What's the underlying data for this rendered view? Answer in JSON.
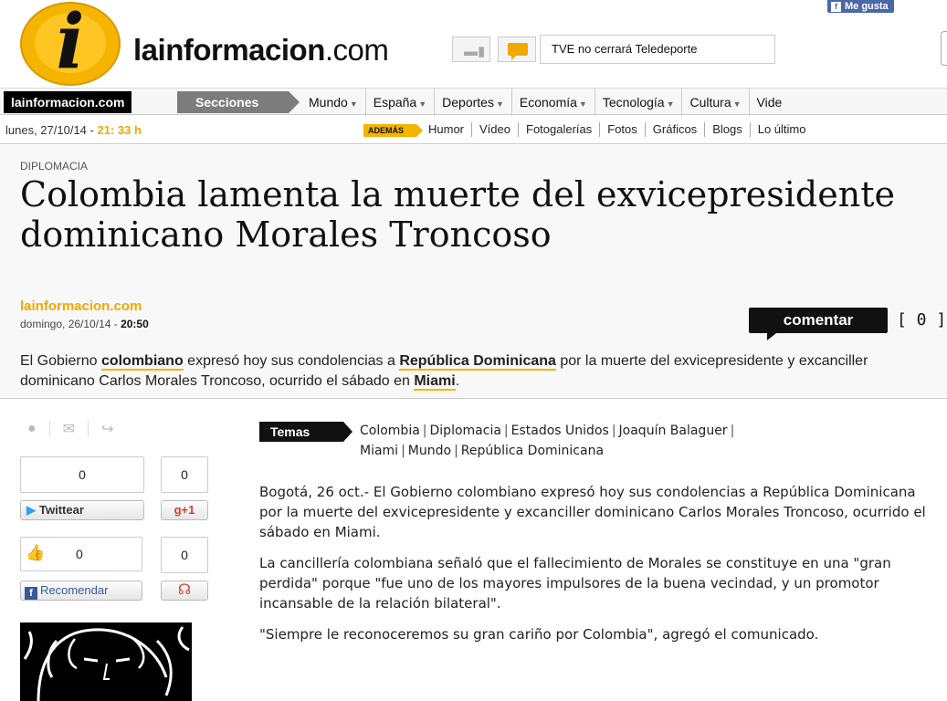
{
  "header": {
    "fb_like_label": "Me gusta",
    "logo_icon": "i",
    "logo_brand": "lainformacion",
    "logo_tld": ".com",
    "headline_ticker": "TVE no cerrará Teledeporte"
  },
  "nav": {
    "brand": "lainformacion.com",
    "sections_label": "Secciones",
    "items": [
      "Mundo",
      "España",
      "Deportes",
      "Economía",
      "Tecnología",
      "Cultura",
      "Vide"
    ]
  },
  "datebar": {
    "date": "lunes, 27/10/14 - ",
    "time": "21: 33 h",
    "ademas_label": "ADEMÁS",
    "links": [
      "Humor",
      "Vídeo",
      "Fotogalerías",
      "Fotos",
      "Gráficos",
      "Blogs",
      "Lo último"
    ]
  },
  "article": {
    "kicker": "DIPLOMACIA",
    "title": "Colombia lamenta la muerte del exvicepresidente dominicano Morales Troncoso",
    "source": "lainformacion.com",
    "pub_day": "domingo, 26/10/14 - ",
    "pub_time": "20:50",
    "comment_label": "comentar",
    "comment_count": "[ 0 ]",
    "lead": {
      "p1": "El Gobierno ",
      "k1": "colombiano",
      "p2": " expresó hoy sus condolencias a ",
      "k2": "República Dominicana",
      "p3": " por la muerte del exvicepresidente y excanciller dominicano Carlos Morales Troncoso, ocurrido el sábado en ",
      "k3": "Miami",
      "p4": "."
    },
    "temas_label": "Temas",
    "topics": [
      "Colombia",
      "Diplomacia",
      "Estados Unidos",
      "Joaquín Balaguer",
      "Miami",
      "Mundo",
      "República Dominicana"
    ],
    "paragraphs": [
      "Bogotá, 26 oct.- El Gobierno colombiano expresó hoy sus condolencias a República Dominicana por la muerte del exvicepresidente y excanciller dominicano Carlos Morales Troncoso, ocurrido el sábado en Miami.",
      "La cancillería colombiana señaló que el fallecimiento de Morales se constituye en una \"gran perdida\" porque \"fue uno de los mayores impulsores de la buena vecindad, y un promotor incansable de la relación bilateral\".",
      "\"Siempre le reconoceremos su gran cariño por Colombia\", agregó el comunicado."
    ]
  },
  "share": {
    "twitter_count": "0",
    "twitter_label": "Twittear",
    "gplus_count": "0",
    "gplus_label": "g+1",
    "facebook_count": "0",
    "facebook_label": "Recomendar",
    "meneame_count": "0"
  }
}
